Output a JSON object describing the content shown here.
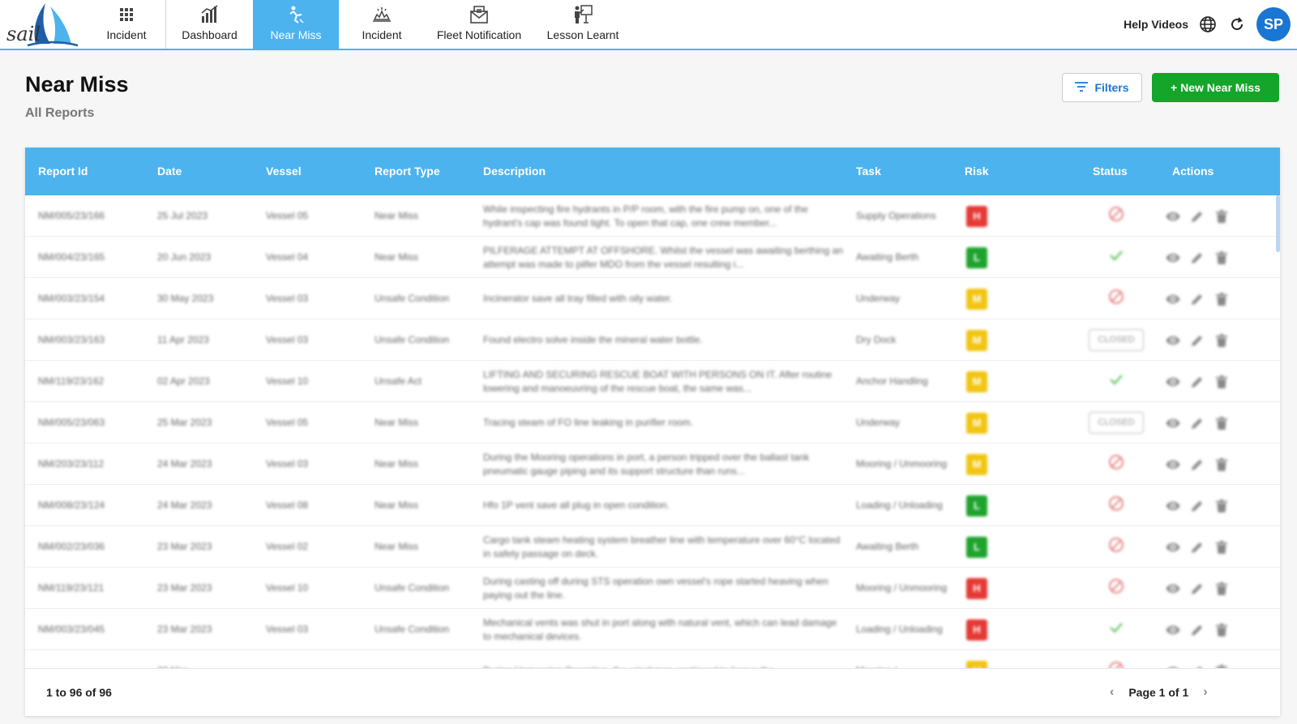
{
  "brand": {
    "logo_text": "sail"
  },
  "nav": [
    {
      "label": "Incident",
      "icon": "grid-icon",
      "active": false
    },
    {
      "label": "Dashboard",
      "icon": "bar-chart-icon",
      "active": false
    },
    {
      "label": "Near Miss",
      "icon": "falling-person-icon",
      "active": true
    },
    {
      "label": "Incident",
      "icon": "crash-icon",
      "active": false
    },
    {
      "label": "Fleet Notification",
      "icon": "envelope-icon",
      "active": false
    },
    {
      "label": "Lesson Learnt",
      "icon": "presenter-icon",
      "active": false
    }
  ],
  "topbar": {
    "help_label": "Help Videos",
    "avatar_initials": "SP"
  },
  "page": {
    "title": "Near Miss",
    "subtitle": "All Reports"
  },
  "toolbar": {
    "filters_label": "Filters",
    "new_label": "+ New Near Miss"
  },
  "table": {
    "columns": [
      "Report Id",
      "Date",
      "Vessel",
      "Report Type",
      "Description",
      "Task",
      "Risk",
      "Status",
      "Actions"
    ],
    "rows": [
      {
        "id": "NM/005/23/166",
        "date": "25 Jul 2023",
        "vessel": "Vessel 05",
        "type": "Near Miss",
        "desc": "While inspecting fire hydrants in P/P room, with the fire pump on, one of the hydrant's cap was found tight. To open that cap, one crew member...",
        "task": "Supply Operations",
        "risk": "H",
        "status": "rejected"
      },
      {
        "id": "NM/004/23/165",
        "date": "20 Jun 2023",
        "vessel": "Vessel 04",
        "type": "Near Miss",
        "desc": "PILFERAGE ATTEMPT AT OFFSHORE. Whilst the vessel was awaiting berthing an attempt was made to pilfer MDO from the vessel resulting i...",
        "task": "Awaiting Berth",
        "risk": "L",
        "status": "approved"
      },
      {
        "id": "NM/003/23/154",
        "date": "30 May 2023",
        "vessel": "Vessel 03",
        "type": "Unsafe Condition",
        "desc": "Incinerator save all tray filled with oily water.",
        "task": "Underway",
        "risk": "M",
        "status": "rejected"
      },
      {
        "id": "NM/003/23/163",
        "date": "11 Apr 2023",
        "vessel": "Vessel 03",
        "type": "Unsafe Condition",
        "desc": "Found electro solve inside the mineral water bottle.",
        "task": "Dry Dock",
        "risk": "M",
        "status": "CLOSED"
      },
      {
        "id": "NM/119/23/162",
        "date": "02 Apr 2023",
        "vessel": "Vessel 10",
        "type": "Unsafe Act",
        "desc": "LIFTING AND SECURING RESCUE BOAT WITH PERSONS ON IT. After routine lowering and manoeuvring of the rescue boat, the same was...",
        "task": "Anchor Handling",
        "risk": "M",
        "status": "approved"
      },
      {
        "id": "NM/005/23/063",
        "date": "25 Mar 2023",
        "vessel": "Vessel 05",
        "type": "Near Miss",
        "desc": "Tracing steam of FO line leaking in purifier room.",
        "task": "Underway",
        "risk": "M",
        "status": "CLOSED"
      },
      {
        "id": "NM/203/23/112",
        "date": "24 Mar 2023",
        "vessel": "Vessel 03",
        "type": "Near Miss",
        "desc": "During the Mooring operations in port, a person tripped over the ballast tank pneumatic gauge piping and its support structure than runs...",
        "task": "Mooring / Unmooring",
        "risk": "M",
        "status": "rejected"
      },
      {
        "id": "NM/008/23/124",
        "date": "24 Mar 2023",
        "vessel": "Vessel 08",
        "type": "Near Miss",
        "desc": "Hfo 1P vent save all plug in open condition.",
        "task": "Loading / Unloading",
        "risk": "L",
        "status": "rejected"
      },
      {
        "id": "NM/002/23/036",
        "date": "23 Mar 2023",
        "vessel": "Vessel 02",
        "type": "Near Miss",
        "desc": "Cargo tank steam heating system breather line with temperature over 60°C located in safety passage on deck.",
        "task": "Awaiting Berth",
        "risk": "L",
        "status": "rejected"
      },
      {
        "id": "NM/119/23/121",
        "date": "23 Mar 2023",
        "vessel": "Vessel 10",
        "type": "Unsafe Condition",
        "desc": "During casting off during STS operation own vessel's rope started heaving when paying out the line.",
        "task": "Mooring / Unmooring",
        "risk": "H",
        "status": "rejected"
      },
      {
        "id": "NM/003/23/045",
        "date": "23 Mar 2023",
        "vessel": "Vessel 03",
        "type": "Unsafe Condition",
        "desc": "Mechanical vents was shut in port along with natural vent, which can lead damage to mechanical devices.",
        "task": "Loading / Unloading",
        "risk": "H",
        "status": "approved"
      },
      {
        "id": "",
        "date": "22 Mar",
        "vessel": "",
        "type": "",
        "desc": "During Unmooring Operation, the winchman continued to heave the",
        "task": "Mooring /",
        "risk": "M",
        "status": "rejected"
      }
    ]
  },
  "footer": {
    "count_text": "1 to 96 of 96",
    "page_text": "Page 1 of 1"
  },
  "colors": {
    "accent": "#4cb3ef",
    "primary": "#1976d2",
    "green": "#14a52a",
    "risk_h": "#e53935",
    "risk_m": "#f2c511",
    "risk_l": "#1fa32e",
    "rejected": "#e57373",
    "approved": "#5cbf5c"
  }
}
